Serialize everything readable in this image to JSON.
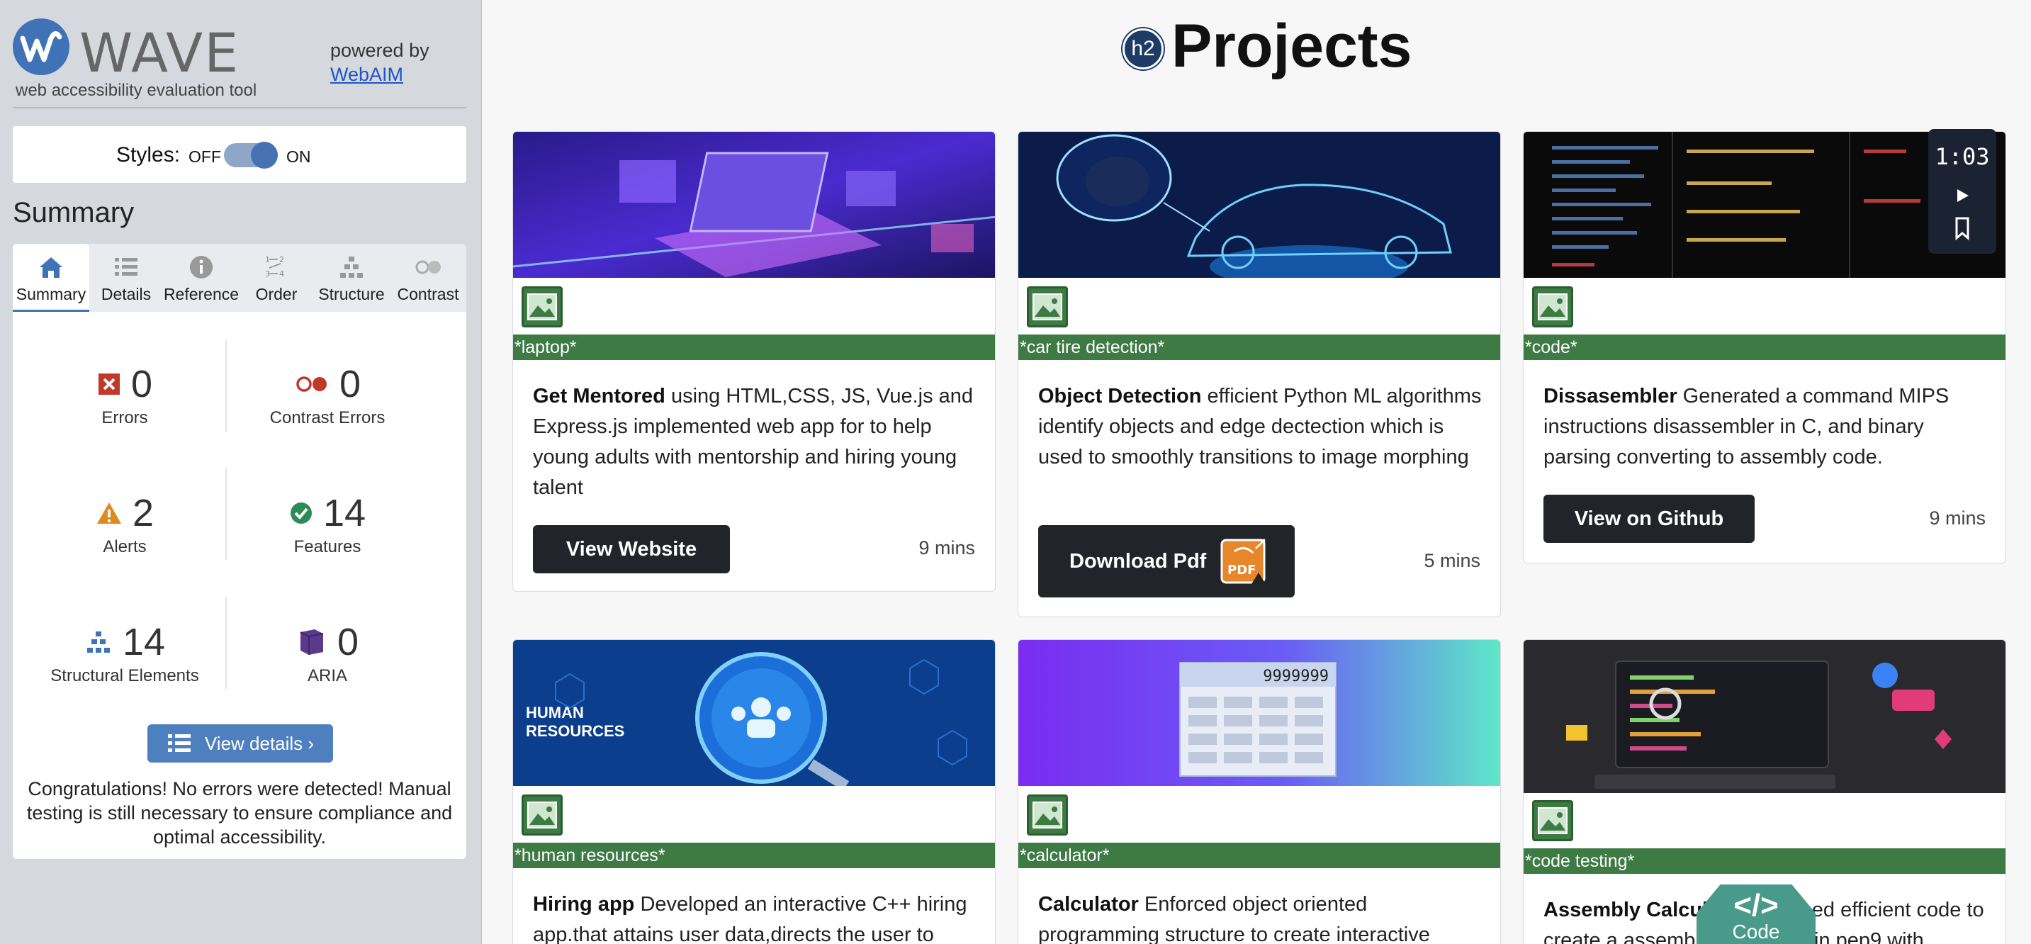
{
  "wave": {
    "brand": "WAVE",
    "subtitle": "web accessibility evaluation tool",
    "powered_by": "powered by",
    "webaim_link": "WebAIM",
    "styles_label": "Styles:",
    "styles_off": "OFF",
    "styles_on": "ON",
    "styles_enabled": true,
    "summary_heading": "Summary",
    "tabs": [
      {
        "label": "Summary",
        "icon": "home-icon",
        "active": true
      },
      {
        "label": "Details",
        "icon": "list-icon",
        "active": false
      },
      {
        "label": "Reference",
        "icon": "info-icon",
        "active": false
      },
      {
        "label": "Order",
        "icon": "order-icon",
        "active": false
      },
      {
        "label": "Structure",
        "icon": "structure-icon",
        "active": false
      },
      {
        "label": "Contrast",
        "icon": "contrast-icon",
        "active": false
      }
    ],
    "stats": {
      "errors": {
        "count": "0",
        "label": "Errors"
      },
      "contrast_errors": {
        "count": "0",
        "label": "Contrast Errors"
      },
      "alerts": {
        "count": "2",
        "label": "Alerts"
      },
      "features": {
        "count": "14",
        "label": "Features"
      },
      "structural": {
        "count": "14",
        "label": "Structural Elements"
      },
      "aria": {
        "count": "0",
        "label": "ARIA"
      }
    },
    "view_details": "View details ›",
    "congrats": "Congratulations! No errors were detected! Manual testing is still necessary to ensure compliance and optimal accessibility.",
    "colors": {
      "accent": "#3f72b6",
      "error": "#c0392b",
      "alert": "#e08a1e",
      "feature": "#2e8b57",
      "aria": "#5b3a8c"
    }
  },
  "page": {
    "h2_badge": "h2",
    "title": "Projects",
    "timer": "1:03",
    "code_badge_symbol": "</>",
    "code_badge_label": "Code",
    "cards": [
      {
        "alt": "*laptop*",
        "title": "Get Mentored",
        "text": " using HTML,CSS, JS, Vue.js and Express.js implemented web app for to help young adults with mentorship and hiring young talent",
        "button": "View Website",
        "mins": "9 mins"
      },
      {
        "alt": "*car tire detection*",
        "title": "Object Detection",
        "text": " efficient Python ML algorithms identify objects and edge dectection which is used to smoothly transitions to image morphing",
        "button": "Download Pdf",
        "mins": "5 mins"
      },
      {
        "alt": "*code*",
        "title": "Dissasembler",
        "text": " Generated a command MIPS instructions disassembler in C, and binary parsing converting to assembly code.",
        "button": "View on Github",
        "mins": "9 mins"
      },
      {
        "alt": "*human resources*",
        "title": "Hiring app",
        "text": " Developed an interactive C++ hiring app.that attains user data,directs the user to"
      },
      {
        "alt": "*calculator*",
        "title": "Calculator",
        "text": " Enforced object oriented programming structure to create interactive"
      },
      {
        "alt": "*code testing*",
        "title": "Assembly Calculator",
        "text": " Enforced efficient code to create a assembly Calculator in pep9 with"
      }
    ],
    "hr_image_text": "HUMAN\nRESOURCES",
    "calc_display": "9999999"
  }
}
